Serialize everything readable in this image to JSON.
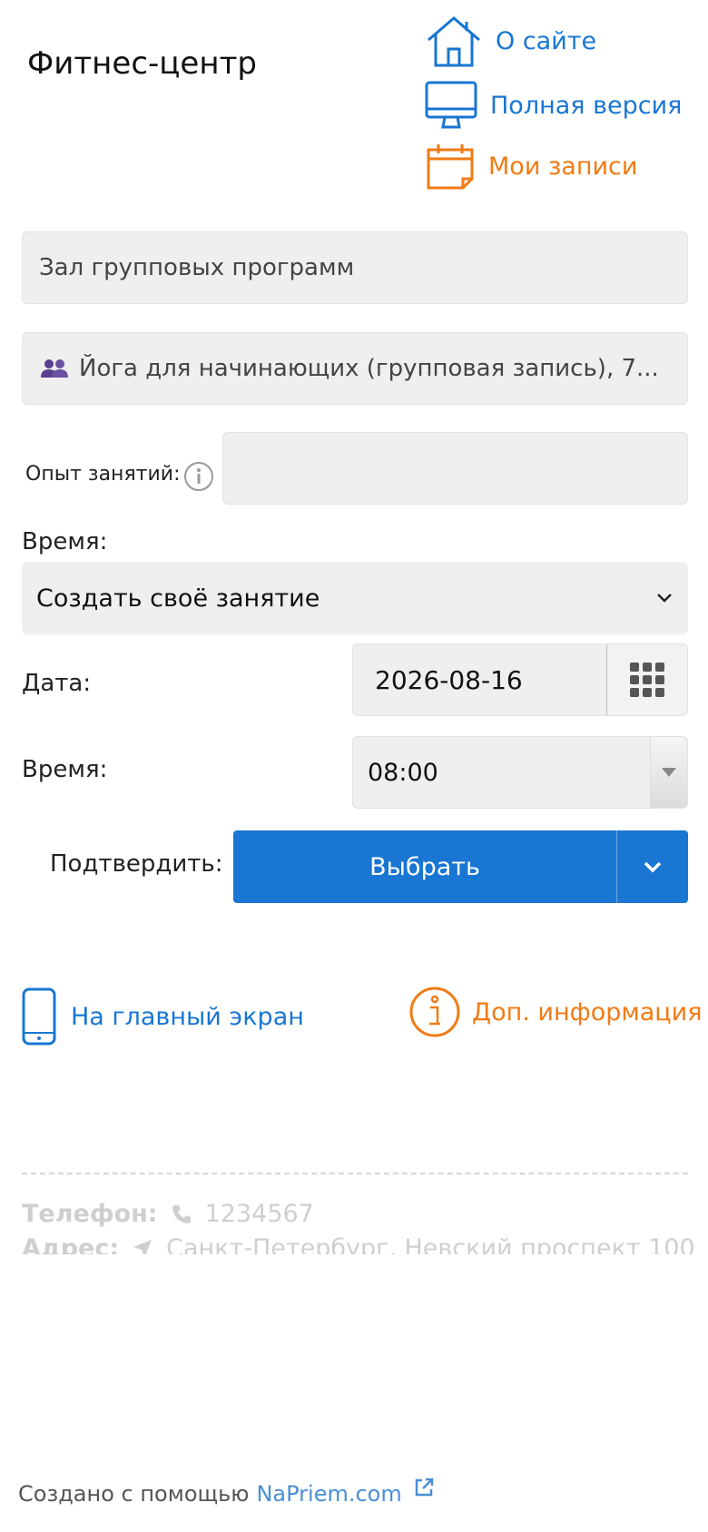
{
  "header": {
    "title": "Фитнес-центр",
    "links": {
      "about": "О сайте",
      "full_version": "Полная версия",
      "my_records": "Мои записи"
    }
  },
  "form": {
    "hall": "Зал групповых программ",
    "program": "Йога для начинающих (групповая запись), 7...",
    "experience_label": "Опыт занятий:",
    "experience_value": "",
    "time_label": "Время:",
    "time_select_value": "Создать своё занятие",
    "date_label": "Дата:",
    "date_value": "2026-08-16",
    "time2_label": "Время:",
    "time2_value": "08:00",
    "confirm_label": "Подтвердить:",
    "choose_button": "Выбрать"
  },
  "nav": {
    "home_screen": "На главный экран",
    "more_info": "Доп. информация"
  },
  "contacts": {
    "phone_label": "Телефон:",
    "phone_value": "1234567",
    "address_label": "Адрес:",
    "address_value": "Санкт-Петербург, Невский проспект 100"
  },
  "footer": {
    "created_with": "Создано с помощью",
    "brand_link": "NaPriem.com"
  },
  "colors": {
    "accent_blue": "#1976d2",
    "accent_orange": "#f07b14",
    "field_bg": "#efefef"
  },
  "icons": [
    "home-icon",
    "monitor-icon",
    "calendar-icon",
    "users-icon",
    "info-icon",
    "chevron-down-icon",
    "grid-icon",
    "caret-down-icon",
    "phone-icon",
    "location-arrow-icon",
    "external-link-icon"
  ]
}
